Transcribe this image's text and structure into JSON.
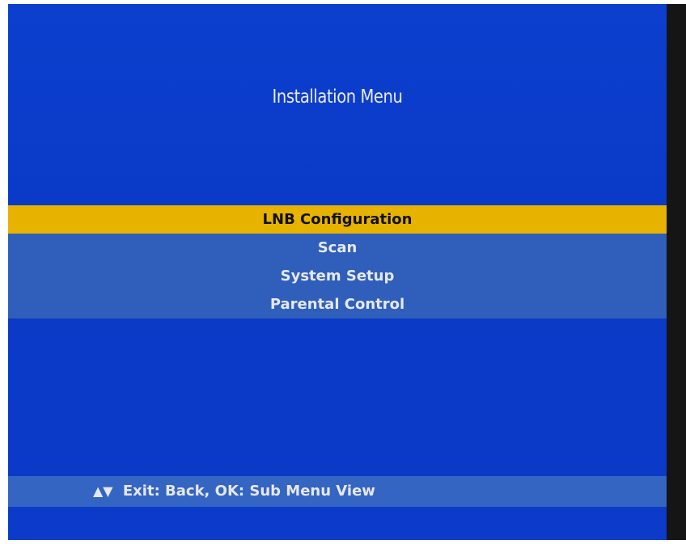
{
  "screen": {
    "title": "Installation Menu"
  },
  "menu": {
    "items": [
      {
        "label": "LNB Configuration",
        "selected": true
      },
      {
        "label": "Scan",
        "selected": false
      },
      {
        "label": "System Setup",
        "selected": false
      },
      {
        "label": "Parental Control",
        "selected": false
      }
    ]
  },
  "footer": {
    "navigation_icons": "▲▼",
    "hint": "Exit: Back, OK: Sub Menu View"
  },
  "colors": {
    "background": "#0b3bc8",
    "menu_band": "#2f5fbb",
    "selected_highlight": "#e7b300",
    "text": "#e6e8f0"
  }
}
